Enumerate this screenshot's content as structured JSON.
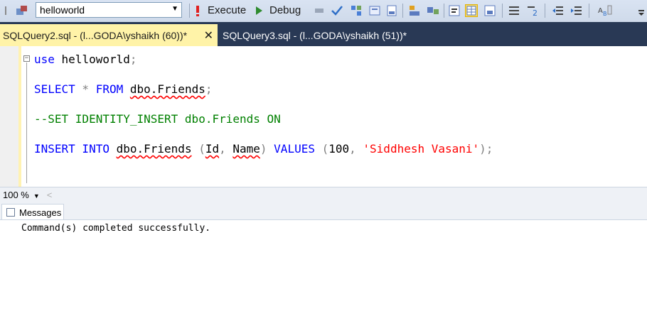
{
  "toolbar": {
    "database": "helloworld",
    "execute_label": "Execute",
    "debug_label": "Debug"
  },
  "tabs": [
    {
      "label": "SQLQuery2.sql - (l...GODA\\yshaikh (60))*",
      "active": true,
      "close": "✕"
    },
    {
      "label": "SQLQuery3.sql - (l...GODA\\yshaikh (51))*",
      "active": false
    }
  ],
  "editor": {
    "lines": [
      "use helloworld;",
      "SELECT * FROM dbo.Friends;",
      "--SET IDENTITY_INSERT dbo.Friends ON",
      "INSERT INTO dbo.Friends (Id, Name) VALUES (100, 'Siddhesh Vasani');"
    ],
    "tokens": {
      "use": "use",
      "helloworld": " helloworld",
      "semi": ";",
      "select": "SELECT",
      "star": " * ",
      "from": "FROM",
      "dbo_friends": "dbo.Friends",
      "comment": "--SET IDENTITY_INSERT dbo.Friends ON",
      "insert_into": "INSERT INTO",
      "paren_open": " (",
      "id": "Id",
      "comma": ", ",
      "name": "Name",
      "paren_close": ") ",
      "values": "VALUES",
      "num": "100",
      "str": "'Siddhesh Vasani'",
      "end": ");"
    }
  },
  "zoom": {
    "level": "100 %"
  },
  "results": {
    "tab_label": "Messages",
    "message": "Command(s) completed successfully."
  },
  "colors": {
    "keyword": "#0000ff",
    "comment": "#008000",
    "string": "#ff0000",
    "tab_active_bg": "#fff3a8",
    "tabbar_bg": "#293955"
  }
}
